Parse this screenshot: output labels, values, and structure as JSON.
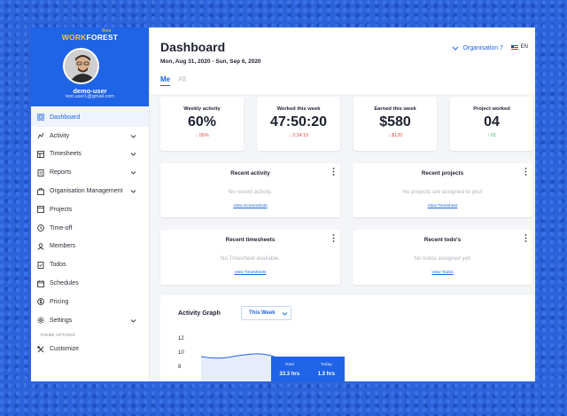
{
  "app": {
    "logo_work": "WORK",
    "logo_forest": "FOREST",
    "logo_tag": "Beta",
    "user": {
      "name": "demo-user",
      "email": "test.user1@gmail.com"
    }
  },
  "sidebar": {
    "items": [
      {
        "label": "Dashboard",
        "icon": "grid-icon",
        "active": true,
        "has_children": false
      },
      {
        "label": "Activity",
        "icon": "activity-icon",
        "active": false,
        "has_children": true
      },
      {
        "label": "Timesheets",
        "icon": "timesheet-icon",
        "active": false,
        "has_children": true
      },
      {
        "label": "Reports",
        "icon": "report-icon",
        "active": false,
        "has_children": true
      },
      {
        "label": "Organisation Management",
        "icon": "organisation-icon",
        "active": false,
        "has_children": true
      },
      {
        "label": "Projects",
        "icon": "projects-icon",
        "active": false,
        "has_children": false
      },
      {
        "label": "Time-off",
        "icon": "time-off-icon",
        "active": false,
        "has_children": false
      },
      {
        "label": "Members",
        "icon": "members-icon",
        "active": false,
        "has_children": false
      },
      {
        "label": "Todos",
        "icon": "todos-icon",
        "active": false,
        "has_children": false
      },
      {
        "label": "Schedules",
        "icon": "calendar-icon",
        "active": false,
        "has_children": false
      },
      {
        "label": "Pricing",
        "icon": "pricing-icon",
        "active": false,
        "has_children": false
      },
      {
        "label": "Settings",
        "icon": "gear-icon",
        "active": false,
        "has_children": true
      }
    ],
    "theme_options": "THEME OPTIONS",
    "customize": "Customize"
  },
  "header": {
    "title": "Dashboard",
    "date_range": "Mon, Aug 31, 2020 - Sun, Sep 6, 2020",
    "organisation": "Organisation 7",
    "language": "EN",
    "tabs": [
      {
        "label": "Me",
        "active": true
      },
      {
        "label": "All",
        "active": false
      }
    ]
  },
  "stats": [
    {
      "label": "Weekly activity",
      "value": "60%",
      "delta": "05%",
      "trend": "down"
    },
    {
      "label": "Worked this week",
      "value": "47:50:20",
      "delta": "2:34:15",
      "trend": "down"
    },
    {
      "label": "Earned this week",
      "value": "$580",
      "delta": "$120",
      "trend": "down"
    },
    {
      "label": "Project worked",
      "value": "04",
      "delta": "01",
      "trend": "up"
    }
  ],
  "panels": {
    "recent_activity": {
      "title": "Recent activity",
      "empty": "No recent activity.",
      "link": "View Screenshots"
    },
    "recent_projects": {
      "title": "Recent projects",
      "empty": "No projects are assigned to you!",
      "link": "View Timesheet"
    },
    "recent_timesheets": {
      "title": "Recent timesheets",
      "empty": "No Timesheet available.",
      "link": "View Timesheets"
    },
    "recent_todos": {
      "title": "Recent todo's",
      "empty": "No todos assigned yet!",
      "link": "View Todos"
    }
  },
  "activity_graph": {
    "title": "Activity Graph",
    "range_select": "This Week",
    "y_ticks": [
      "12",
      "10",
      "8"
    ],
    "tooltip": {
      "total_label": "Total",
      "total_value": "33.3 hrs",
      "today_label": "Today",
      "today_value": "1.3 hrs"
    }
  },
  "colors": {
    "accent": "#1f63e6",
    "negative": "#e34848",
    "positive": "#2fb86a"
  }
}
